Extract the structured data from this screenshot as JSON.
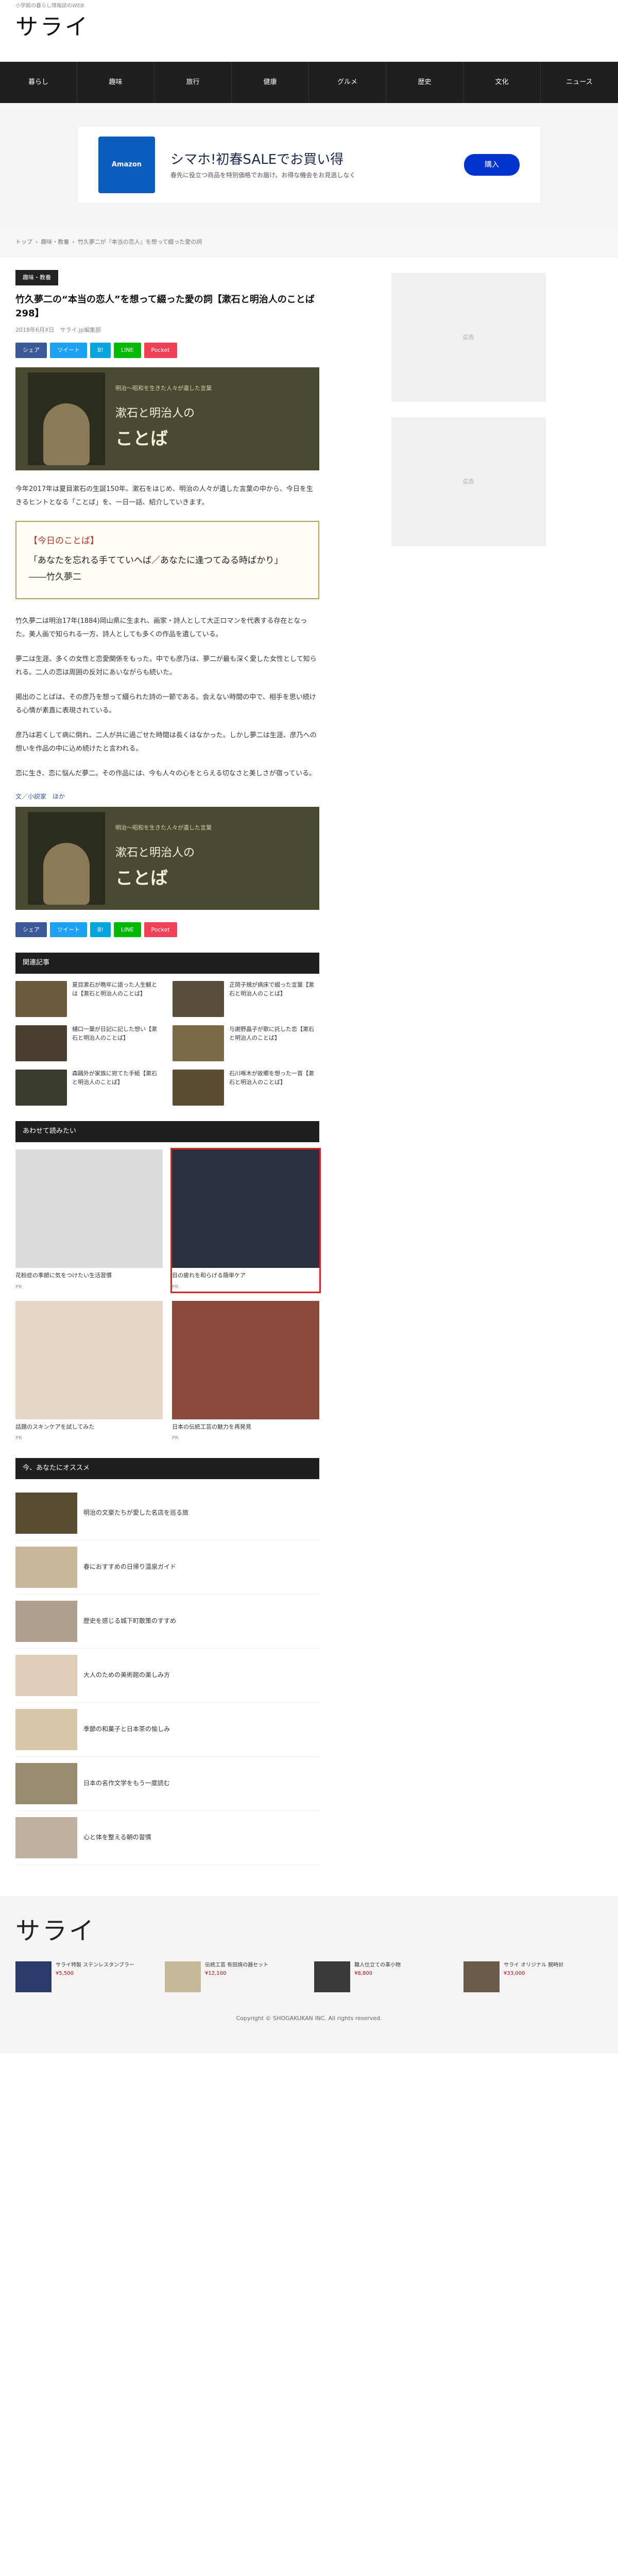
{
  "site": {
    "logo_small": "小学館の暮らし情報誌のWEB",
    "logo": "サライ"
  },
  "nav": [
    {
      "label": "暮らし"
    },
    {
      "label": "趣味"
    },
    {
      "label": "旅行"
    },
    {
      "label": "健康"
    },
    {
      "label": "グルメ"
    },
    {
      "label": "歴史"
    },
    {
      "label": "文化"
    },
    {
      "label": "ニュース"
    }
  ],
  "ad_top": {
    "brand": "Amazon",
    "title": "シマホ!初春SALEでお買い得",
    "sub": "春先に役立つ商品を特別価格でお届け。お得な機会をお見逃しなく",
    "button": "購入"
  },
  "breadcrumb": [
    "トップ",
    "趣味・教養",
    "竹久夢二が『本当の恋人』を想って綴った愛の詞"
  ],
  "article": {
    "category": "趣味・教養",
    "title": "竹久夢二の“本当の恋人”を想って綴った愛の詞【漱石と明治人のことば298】",
    "meta": "2018年6月X日　サライ.jp編集部",
    "share": [
      "シェア",
      "ツイート",
      "B!",
      "LINE",
      "Pocket"
    ],
    "banner_small": "明治〜昭和を生きた人々が遺した言葉",
    "banner_big": "漱石と明治人の",
    "banner_big2": "ことば",
    "intro": "今年2017年は夏目漱石の生誕150年。漱石をはじめ、明治の人々が遺した言葉の中から、今日を生きるヒントとなる「ことば」を、一日一話、紹介していきます。",
    "quote_head": "【今日のことば】",
    "quote_lines": [
      "「あなたを忘れる手てていへば／あなたに逢つてゐる時ばかり」",
      "――竹久夢二"
    ],
    "paragraphs": [
      "竹久夢二は明治17年(1884)岡山県に生まれ、画家・詩人として大正ロマンを代表する存在となった。美人画で知られる一方、詩人としても多くの作品を遺している。",
      "夢二は生涯、多くの女性と恋愛関係をもった。中でも彦乃は、夢二が最も深く愛した女性として知られる。二人の恋は周囲の反対にあいながらも続いた。",
      "掲出のことばは、その彦乃を想って綴られた詩の一節である。会えない時間の中で、相手を思い続ける心情が素直に表現されている。",
      "彦乃は若くして病に倒れ、二人が共に過ごせた時間は長くはなかった。しかし夢二は生涯、彦乃への想いを作品の中に込め続けたと言われる。",
      "恋に生き、恋に悩んだ夢二。その作品には、今も人々の心をとらえる切なさと美しさが宿っている。"
    ],
    "more": "文／小説家　ほか"
  },
  "related_header": "関連記事",
  "related": [
    {
      "title": "夏目漱石が晩年に語った人生観とは【漱石と明治人のことば】"
    },
    {
      "title": "正岡子規が病床で綴った言葉【漱石と明治人のことば】"
    },
    {
      "title": "樋口一葉が日記に記した想い【漱石と明治人のことば】"
    },
    {
      "title": "与謝野晶子が歌に託した恋【漱石と明治人のことば】"
    },
    {
      "title": "森鷗外が家族に宛てた手紙【漱石と明治人のことば】"
    },
    {
      "title": "石川啄木が故郷を想った一首【漱石と明治人のことば】"
    }
  ],
  "photo_header": "あわせて読みたい",
  "photos": [
    {
      "cap": "花粉症の季節に気をつけたい生活習慣",
      "src": "PR"
    },
    {
      "cap": "目の疲れを和らげる簡単ケア",
      "src": "PR"
    },
    {
      "cap": "話題のスキンケアを試してみた",
      "src": "PR"
    },
    {
      "cap": "日本の伝統工芸の魅力を再発見",
      "src": "PR"
    }
  ],
  "rec_header": "今、あなたにオススメ",
  "rec": [
    {
      "title": "明治の文豪たちが愛した名店を巡る旅"
    },
    {
      "title": "春におすすめの日帰り温泉ガイド"
    },
    {
      "title": "歴史を感じる城下町散策のすすめ"
    },
    {
      "title": "大人のための美術館の楽しみ方"
    },
    {
      "title": "季節の和菓子と日本茶の愉しみ"
    },
    {
      "title": "日本の名作文学をもう一度読む"
    },
    {
      "title": "心と体を整える朝の習慣"
    }
  ],
  "footer": {
    "logo": "サライ",
    "products": [
      {
        "title": "サライ特製 ステンレスタンブラー",
        "price": "¥5,500"
      },
      {
        "title": "伝統工芸 有田焼の器セット",
        "price": "¥12,100"
      },
      {
        "title": "職人仕立ての革小物",
        "price": "¥8,800"
      },
      {
        "title": "サライ オリジナル 腕時計",
        "price": "¥33,000"
      }
    ],
    "copyright": "Copyright © SHOGAKUKAN INC. All rights reserved."
  },
  "side_ad": "広告"
}
